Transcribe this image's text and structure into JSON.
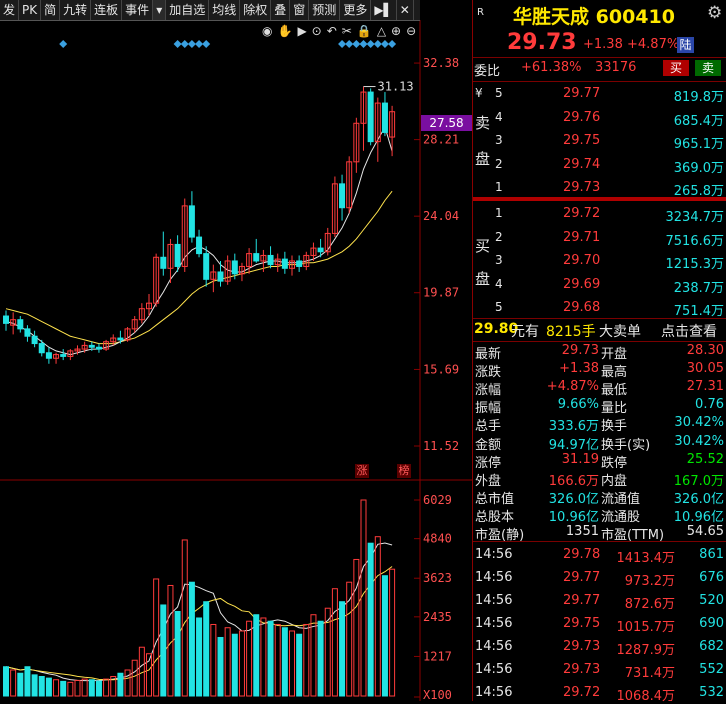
{
  "toolbar": {
    "items": [
      "发",
      "PK",
      "简",
      "九转",
      "连板",
      "事件",
      "▾",
      "加自选",
      "均线",
      "除权",
      "叠",
      "窗",
      "预测",
      "更多",
      "▶▌",
      "✕"
    ]
  },
  "chart": {
    "price_labels": [
      "32.38",
      "28.21",
      "24.04",
      "19.87",
      "15.69",
      "11.52"
    ],
    "current_price_tag": "27.58",
    "high_marker": "31.13",
    "volume_labels": [
      "6029",
      "4840",
      "3623",
      "2435",
      "1217",
      "X100"
    ],
    "bottom_tags": [
      "涨",
      "榜"
    ]
  },
  "chart_data": {
    "type": "candlestick",
    "candles": [
      {
        "o": 18.6,
        "h": 18.9,
        "l": 17.8,
        "c": 18.2
      },
      {
        "o": 18.1,
        "h": 18.8,
        "l": 17.6,
        "c": 18.4
      },
      {
        "o": 18.4,
        "h": 18.6,
        "l": 17.7,
        "c": 17.9
      },
      {
        "o": 17.9,
        "h": 18.1,
        "l": 17.2,
        "c": 17.5
      },
      {
        "o": 17.5,
        "h": 17.8,
        "l": 16.9,
        "c": 17.1
      },
      {
        "o": 17.1,
        "h": 17.3,
        "l": 16.4,
        "c": 16.6
      },
      {
        "o": 16.6,
        "h": 16.9,
        "l": 16.0,
        "c": 16.3
      },
      {
        "o": 16.3,
        "h": 16.6,
        "l": 16.0,
        "c": 16.5
      },
      {
        "o": 16.5,
        "h": 16.8,
        "l": 16.2,
        "c": 16.4
      },
      {
        "o": 16.4,
        "h": 16.8,
        "l": 16.2,
        "c": 16.7
      },
      {
        "o": 16.7,
        "h": 17.0,
        "l": 16.5,
        "c": 16.8
      },
      {
        "o": 16.8,
        "h": 17.2,
        "l": 16.6,
        "c": 17.0
      },
      {
        "o": 17.0,
        "h": 17.2,
        "l": 16.7,
        "c": 16.9
      },
      {
        "o": 16.9,
        "h": 17.1,
        "l": 16.6,
        "c": 16.8
      },
      {
        "o": 16.8,
        "h": 17.3,
        "l": 16.7,
        "c": 17.2
      },
      {
        "o": 17.2,
        "h": 17.6,
        "l": 17.0,
        "c": 17.4
      },
      {
        "o": 17.4,
        "h": 17.8,
        "l": 17.1,
        "c": 17.3
      },
      {
        "o": 17.3,
        "h": 18.0,
        "l": 17.2,
        "c": 17.9
      },
      {
        "o": 17.9,
        "h": 18.6,
        "l": 17.7,
        "c": 18.4
      },
      {
        "o": 18.4,
        "h": 19.3,
        "l": 18.2,
        "c": 19.0
      },
      {
        "o": 19.0,
        "h": 19.8,
        "l": 18.6,
        "c": 19.3
      },
      {
        "o": 19.3,
        "h": 22.0,
        "l": 19.1,
        "c": 21.8
      },
      {
        "o": 21.8,
        "h": 23.2,
        "l": 20.8,
        "c": 21.2
      },
      {
        "o": 21.2,
        "h": 22.8,
        "l": 20.4,
        "c": 22.5
      },
      {
        "o": 22.5,
        "h": 23.0,
        "l": 21.0,
        "c": 21.3
      },
      {
        "o": 21.3,
        "h": 25.0,
        "l": 21.0,
        "c": 24.6
      },
      {
        "o": 24.6,
        "h": 25.4,
        "l": 22.6,
        "c": 22.9
      },
      {
        "o": 22.9,
        "h": 23.3,
        "l": 21.8,
        "c": 22.0
      },
      {
        "o": 22.0,
        "h": 22.4,
        "l": 20.2,
        "c": 20.6
      },
      {
        "o": 20.6,
        "h": 21.4,
        "l": 19.9,
        "c": 21.0
      },
      {
        "o": 21.0,
        "h": 21.6,
        "l": 20.2,
        "c": 20.5
      },
      {
        "o": 20.5,
        "h": 21.9,
        "l": 20.3,
        "c": 21.6
      },
      {
        "o": 21.6,
        "h": 22.0,
        "l": 20.6,
        "c": 20.9
      },
      {
        "o": 20.9,
        "h": 21.5,
        "l": 20.5,
        "c": 21.3
      },
      {
        "o": 21.3,
        "h": 22.3,
        "l": 20.9,
        "c": 22.0
      },
      {
        "o": 22.0,
        "h": 22.8,
        "l": 21.5,
        "c": 21.6
      },
      {
        "o": 21.6,
        "h": 22.2,
        "l": 21.0,
        "c": 21.9
      },
      {
        "o": 21.9,
        "h": 22.4,
        "l": 21.2,
        "c": 21.4
      },
      {
        "o": 21.4,
        "h": 22.0,
        "l": 21.0,
        "c": 21.7
      },
      {
        "o": 21.7,
        "h": 22.1,
        "l": 20.9,
        "c": 21.2
      },
      {
        "o": 21.2,
        "h": 21.9,
        "l": 20.8,
        "c": 21.6
      },
      {
        "o": 21.6,
        "h": 21.9,
        "l": 21.0,
        "c": 21.3
      },
      {
        "o": 21.3,
        "h": 22.1,
        "l": 21.1,
        "c": 21.9
      },
      {
        "o": 21.9,
        "h": 22.6,
        "l": 21.6,
        "c": 22.3
      },
      {
        "o": 22.3,
        "h": 22.8,
        "l": 21.8,
        "c": 22.1
      },
      {
        "o": 22.1,
        "h": 23.4,
        "l": 21.9,
        "c": 23.1
      },
      {
        "o": 23.1,
        "h": 26.2,
        "l": 22.9,
        "c": 25.8
      },
      {
        "o": 25.8,
        "h": 26.3,
        "l": 23.8,
        "c": 24.5
      },
      {
        "o": 24.5,
        "h": 27.3,
        "l": 24.2,
        "c": 27.0
      },
      {
        "o": 27.0,
        "h": 29.4,
        "l": 26.4,
        "c": 29.1
      },
      {
        "o": 29.1,
        "h": 31.1,
        "l": 27.6,
        "c": 30.8
      },
      {
        "o": 30.8,
        "h": 31.0,
        "l": 27.9,
        "c": 28.1
      },
      {
        "o": 28.1,
        "h": 30.5,
        "l": 27.0,
        "c": 30.2
      },
      {
        "o": 30.2,
        "h": 30.8,
        "l": 28.4,
        "c": 28.6
      },
      {
        "o": 28.35,
        "h": 30.05,
        "l": 27.31,
        "c": 29.73
      }
    ],
    "ma_fast": [
      18.3,
      18.2,
      18.0,
      17.8,
      17.5,
      17.2,
      16.9,
      16.7,
      16.6,
      16.5,
      16.6,
      16.7,
      16.8,
      16.8,
      16.9,
      17.0,
      17.2,
      17.4,
      17.7,
      18.1,
      18.6,
      19.3,
      19.9,
      20.6,
      21.1,
      21.8,
      22.2,
      22.4,
      22.2,
      21.9,
      21.4,
      21.1,
      21.0,
      21.0,
      21.2,
      21.4,
      21.5,
      21.6,
      21.6,
      21.5,
      21.5,
      21.5,
      21.6,
      21.7,
      21.9,
      22.2,
      22.8,
      23.4,
      24.2,
      25.3,
      26.6,
      27.5,
      28.2,
      28.9,
      27.58
    ],
    "ma_slow": [
      19.0,
      18.9,
      18.8,
      18.7,
      18.5,
      18.3,
      18.1,
      17.9,
      17.7,
      17.5,
      17.4,
      17.3,
      17.2,
      17.1,
      17.1,
      17.1,
      17.2,
      17.3,
      17.4,
      17.6,
      17.8,
      18.1,
      18.4,
      18.7,
      19.0,
      19.4,
      19.8,
      20.1,
      20.3,
      20.5,
      20.6,
      20.7,
      20.8,
      20.9,
      21.0,
      21.1,
      21.2,
      21.3,
      21.3,
      21.4,
      21.4,
      21.4,
      21.5,
      21.5,
      21.6,
      21.7,
      21.9,
      22.1,
      22.4,
      22.8,
      23.3,
      23.8,
      24.3,
      24.9,
      25.4
    ],
    "volumes": [
      900,
      800,
      700,
      900,
      650,
      600,
      550,
      500,
      450,
      420,
      480,
      520,
      500,
      460,
      520,
      600,
      700,
      800,
      1100,
      1500,
      1300,
      3600,
      2800,
      3400,
      2600,
      4800,
      3500,
      2400,
      2900,
      2200,
      1800,
      2100,
      1900,
      2000,
      2300,
      2500,
      2400,
      2300,
      2200,
      2100,
      2000,
      1900,
      2200,
      2500,
      2300,
      2700,
      3300,
      2900,
      3500,
      4200,
      6029,
      4700,
      4900,
      3700,
      3900
    ],
    "ylim": [
      11.52,
      33.0
    ]
  },
  "quote": {
    "name": "华胜天成",
    "code": "600410",
    "price": "29.73",
    "change": "+1.38",
    "change_pct": "+4.87%",
    "badge": "陆",
    "r_tag": "R",
    "gear": "⚙"
  },
  "weibi": {
    "label": "委比",
    "ratio": "+61.38%",
    "diff": "33176",
    "buy_btn": "买",
    "sell_btn": "卖"
  },
  "asks": [
    {
      "level": "5",
      "price": "29.77",
      "vol": "819.8万"
    },
    {
      "level": "4",
      "price": "29.76",
      "vol": "685.4万"
    },
    {
      "level": "3",
      "price": "29.75",
      "vol": "965.1万"
    },
    {
      "level": "2",
      "price": "29.74",
      "vol": "369.0万"
    },
    {
      "level": "1",
      "price": "29.73",
      "vol": "265.8万"
    }
  ],
  "bids": [
    {
      "level": "1",
      "price": "29.72",
      "vol": "3234.7万"
    },
    {
      "level": "2",
      "price": "29.71",
      "vol": "7516.6万"
    },
    {
      "level": "3",
      "price": "29.70",
      "vol": "1215.3万"
    },
    {
      "level": "4",
      "price": "29.69",
      "vol": "238.7万"
    },
    {
      "level": "5",
      "price": "29.68",
      "vol": "751.4万"
    }
  ],
  "side_labels": {
    "ask_symbol": "¥",
    "ask1": "卖",
    "ask2": "盘",
    "bid1": "买",
    "bid2": "盘"
  },
  "big_order": {
    "price": "29.80",
    "unit1": "元有",
    "qty": "8215手",
    "label": "大卖单",
    "link": "点击查看"
  },
  "stats": [
    {
      "l1": "最新",
      "v1": "29.73",
      "c1": "red",
      "l2": "开盘",
      "v2": "28.30",
      "c2": "red"
    },
    {
      "l1": "涨跌",
      "v1": "+1.38",
      "c1": "red",
      "l2": "最高",
      "v2": "30.05",
      "c2": "red"
    },
    {
      "l1": "涨幅",
      "v1": "+4.87%",
      "c1": "red",
      "l2": "最低",
      "v2": "27.31",
      "c2": "red"
    },
    {
      "l1": "振幅",
      "v1": "9.66%",
      "c1": "cyan",
      "l2": "量比",
      "v2": "0.76",
      "c2": "cyan"
    },
    {
      "l1": "总手",
      "v1": "333.6万",
      "c1": "cyan",
      "l2": "换手",
      "v2": "30.42%",
      "c2": "cyan"
    },
    {
      "l1": "金额",
      "v1": "94.97亿",
      "c1": "cyan",
      "l2": "换手(实)",
      "v2": "30.42%",
      "c2": "cyan"
    },
    {
      "l1": "涨停",
      "v1": "31.19",
      "c1": "red",
      "l2": "跌停",
      "v2": "25.52",
      "c2": "green"
    },
    {
      "l1": "外盘",
      "v1": "166.6万",
      "c1": "red",
      "l2": "内盘",
      "v2": "167.0万",
      "c2": "green"
    },
    {
      "l1": "总市值",
      "v1": "326.0亿",
      "c1": "cyan",
      "l2": "流通值",
      "v2": "326.0亿",
      "c2": "cyan"
    },
    {
      "l1": "总股本",
      "v1": "10.96亿",
      "c1": "cyan",
      "l2": "流通股",
      "v2": "10.96亿",
      "c2": "cyan"
    },
    {
      "l1": "市盈(静)",
      "v1": "1351",
      "c1": "white",
      "l2": "市盈(TTM)",
      "v2": "54.65",
      "c2": "white"
    }
  ],
  "ticks": [
    {
      "t": "14:56",
      "p": "29.78",
      "a": "1413.4万",
      "n": "861"
    },
    {
      "t": "14:56",
      "p": "29.77",
      "a": "973.2万",
      "n": "676"
    },
    {
      "t": "14:56",
      "p": "29.77",
      "a": "872.6万",
      "n": "520"
    },
    {
      "t": "14:56",
      "p": "29.75",
      "a": "1015.7万",
      "n": "690"
    },
    {
      "t": "14:56",
      "p": "29.73",
      "a": "1287.9万",
      "n": "682"
    },
    {
      "t": "14:56",
      "p": "29.73",
      "a": "731.4万",
      "n": "552"
    },
    {
      "t": "14:56",
      "p": "29.72",
      "a": "1068.4万",
      "n": "532"
    }
  ],
  "colors": {
    "up": "#ff3b3b",
    "down": "#22e3e3",
    "ma_fast": "#e6e6e6",
    "ma_slow": "#ffe34d",
    "axis": "#8a0000"
  }
}
